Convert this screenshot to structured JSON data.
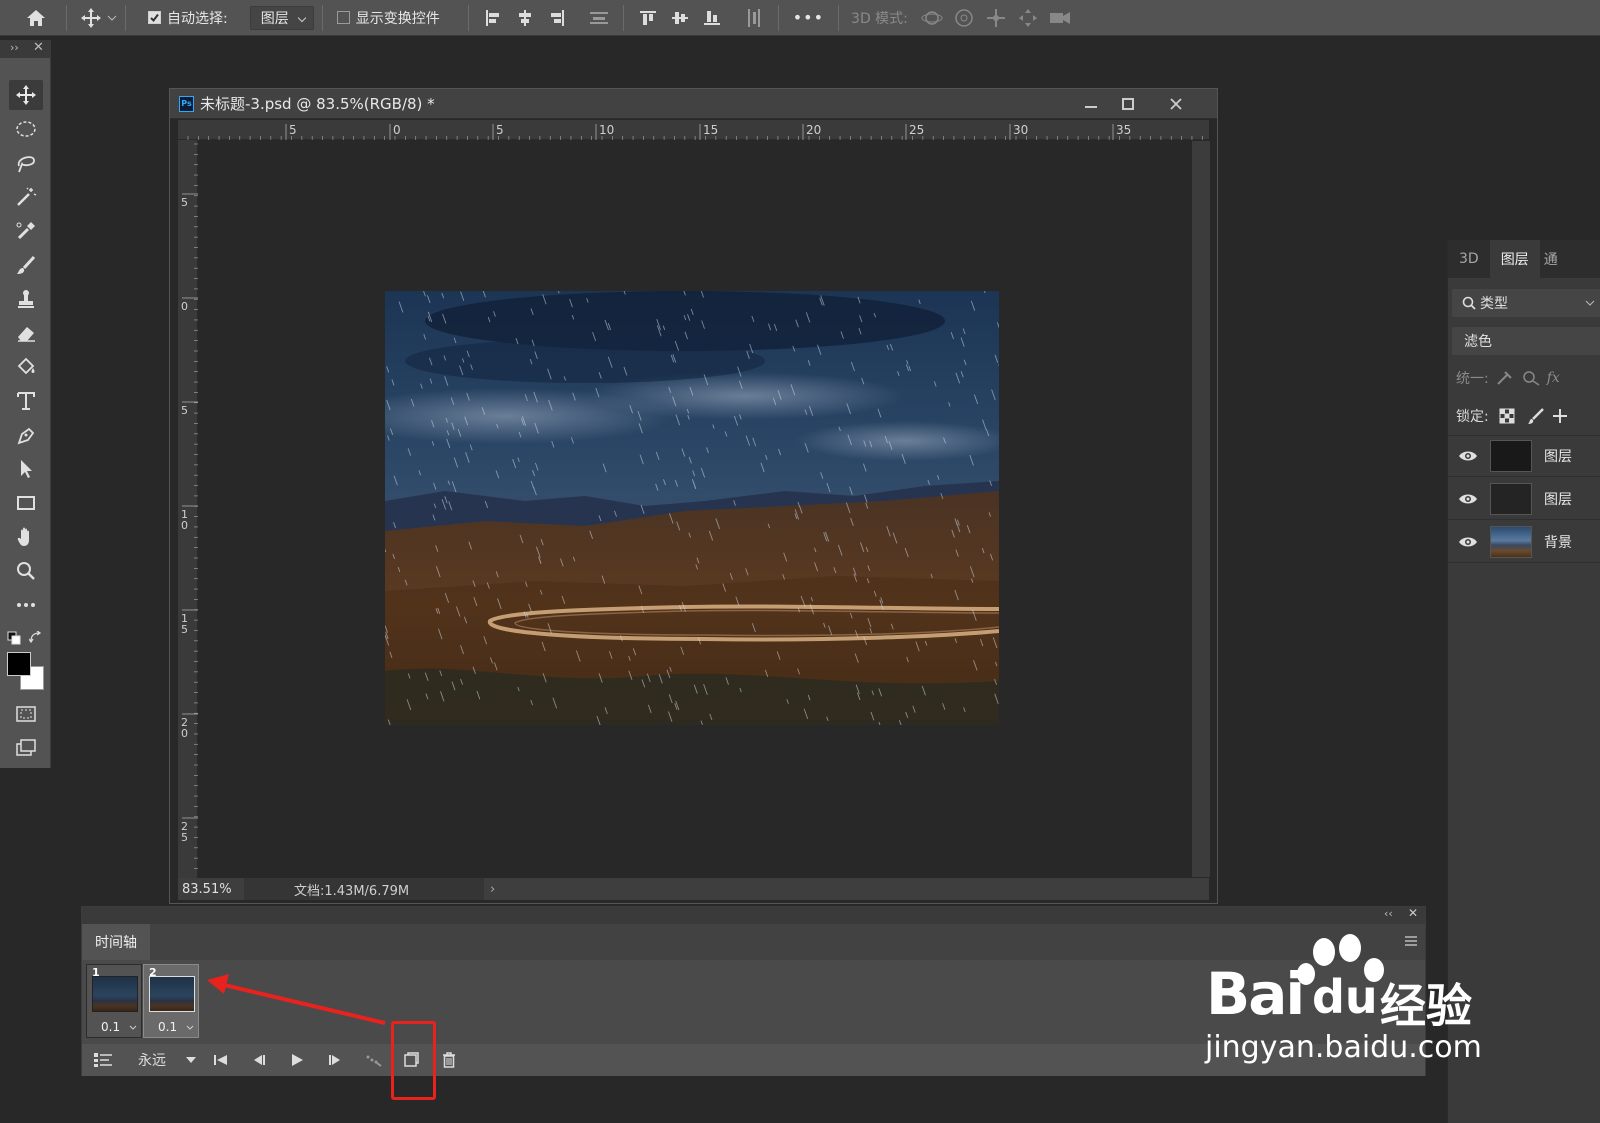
{
  "options_bar": {
    "auto_select_label": "自动选择:",
    "auto_select_value": "图层",
    "show_transform_label": "显示变换控件",
    "more_label": "•••",
    "mode_3d_label": "3D 模式:"
  },
  "document": {
    "title": "未标题-3.psd @ 83.5%(RGB/8) *",
    "zoom": "83.51%",
    "doc_info": "文档:1.43M/6.79M",
    "ruler_top": [
      "5",
      "0",
      "5",
      "10",
      "15",
      "20",
      "25",
      "30",
      "35"
    ],
    "ruler_left": [
      "5",
      "0",
      "5",
      "1\n0",
      "1\n5",
      "2\n0",
      "2\n5"
    ]
  },
  "right_panel": {
    "tabs": [
      "3D",
      "图层",
      "通"
    ],
    "filter_type": "类型",
    "blend_mode": "滤色",
    "unify_label": "统一:",
    "lock_label": "锁定:",
    "layers": [
      {
        "name": "图层",
        "thumb": "dark"
      },
      {
        "name": "图层",
        "thumb": "dark"
      },
      {
        "name": "背景",
        "thumb": "photo"
      }
    ]
  },
  "timeline": {
    "title": "时间轴",
    "loop": "永远",
    "frames": [
      {
        "num": "1",
        "delay": "0.1"
      },
      {
        "num": "2",
        "delay": "0.1"
      }
    ]
  },
  "watermark": {
    "brand": "Bai",
    "brand2": "du",
    "brand_cn": "经验",
    "url": "jingyan.baidu.com"
  },
  "colors": {
    "accent_red": "#e8221d",
    "panel": "#535353",
    "canvas_bg": "#282828"
  }
}
